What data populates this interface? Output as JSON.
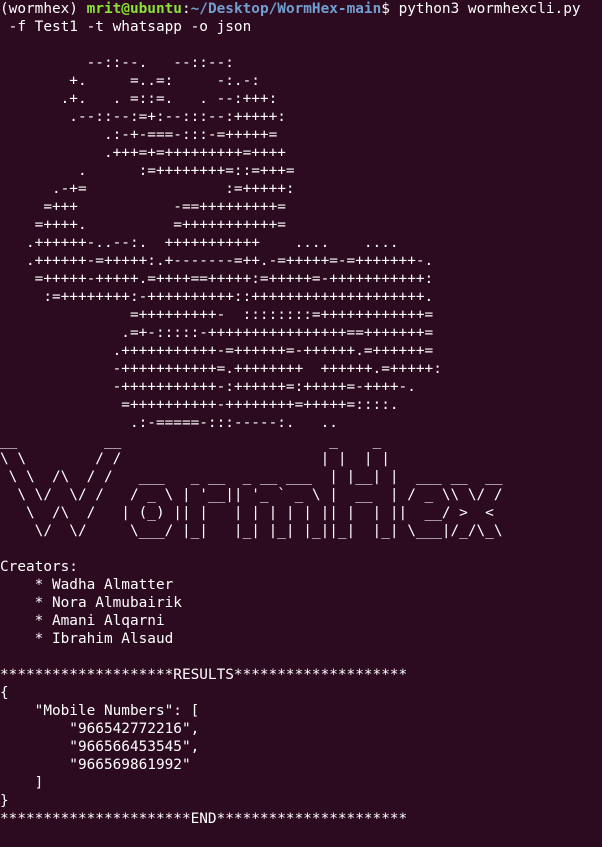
{
  "prompt": {
    "env": "(wormhex)",
    "user_host": "mrit@ubuntu",
    "colon": ":",
    "path": "~/Desktop/WormHex-main",
    "dollar": "$",
    "command": "python3 wormhexcli.py",
    "command_cont": " -f Test1 -t whatsapp -o json"
  },
  "logo_art": [
    "",
    "          --::--.   --::--:",
    "        +.     =..=:     -:.-:",
    "       .+.   . =::=.   . --:+++:",
    "        .--::--:=+:--:::--:+++++:",
    "            .:-+-===-:::-=+++++=",
    "            .+++=+=+++++++++=++++",
    "         .      :=++++++++=::=+++=",
    "      .-+=                :=+++++:",
    "     =+++           -==+++++++++=",
    "    =++++.          =+++++++++++=",
    "   .++++++-..--:.  +++++++++++    ....    ....",
    "   .++++++-=+++++:.+-------=++.-=+++++=-=+++++++-.",
    "    =+++++-+++++.=++++==+++++:=+++++=-+++++++++++:",
    "     :=++++++++:-++++++++++::++++++++++++++++++++.",
    "               =+++++++++-  ::::::::=++++++++++++=",
    "              .=+-:::::-++++++++++++++++==+++++++=",
    "             .+++++++++++-=++++++=-++++++.=++++++=",
    "             -+++++++++++=.++++++++  ++++++.=+++++:",
    "             -+++++++++++-:++++++=:+++++=-++++-.",
    "              =++++++++++-++++++++=+++++=::::.",
    "               .:-=====-:::-----:.   .."
  ],
  "figlet_banner": [
    "__          __                        _    _",
    "\\ \\        / /                       | |  | |",
    " \\ \\  /\\  / /   ___   _ __  _ __ ___  | |__| |  ___ __  __",
    "  \\ \\/  \\/ /   / _ \\ | '__|| '_ ` _ \\ |  __  | / _ \\\\ \\/ /",
    "   \\  /\\  /   | (_) || |   | | | | | || |  | ||  __/ >  <",
    "    \\/  \\/     \\___/ |_|   |_| |_| |_||_|  |_| \\___|/_/\\_\\"
  ],
  "creators": {
    "heading": "Creators:",
    "names": [
      "    * Wadha Almatter",
      "    * Nora Almubairik",
      "    * Amani Alqarni",
      "    * Ibrahim Alsaud"
    ]
  },
  "results": {
    "header": "********************RESULTS********************",
    "json_lines": [
      "{",
      "    \"Mobile Numbers\": [",
      "        \"966542772216\",",
      "        \"966566453545\",",
      "        \"966569861992\"",
      "    ]",
      "}"
    ],
    "footer": "**********************END**********************"
  }
}
